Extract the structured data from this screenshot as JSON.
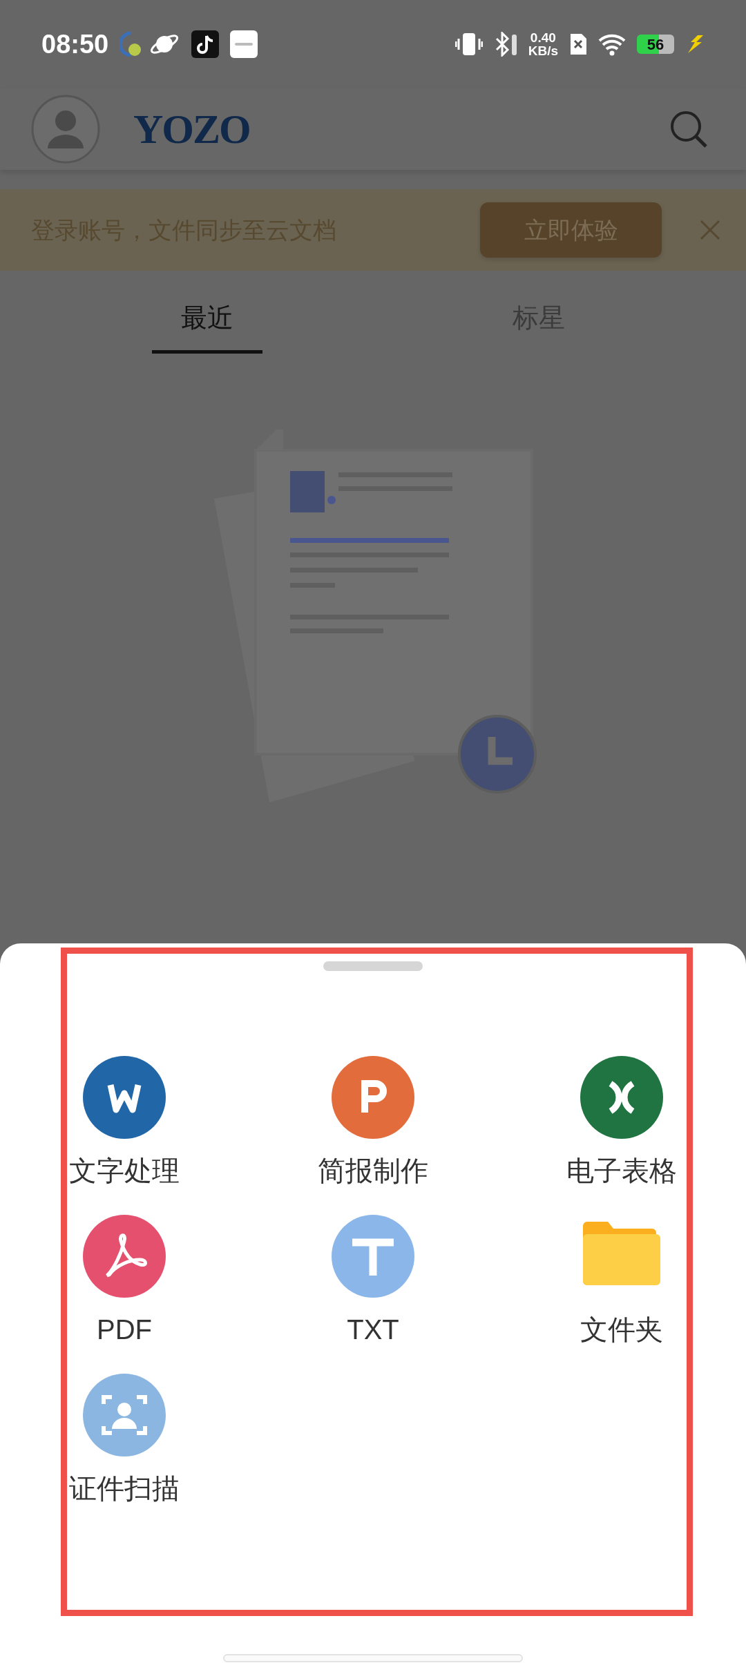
{
  "status_bar": {
    "time": "08:50",
    "network_speed": {
      "value": "0.40",
      "unit": "KB/s"
    },
    "battery": "56"
  },
  "header": {
    "logo": "YOZO"
  },
  "banner": {
    "text": "登录账号，文件同步至云文档",
    "button": "立即体验"
  },
  "tabs": [
    {
      "label": "最近",
      "selected": true
    },
    {
      "label": "标星",
      "selected": false
    }
  ],
  "new_sheet": {
    "items": [
      {
        "label": "文字处理",
        "kind": "word"
      },
      {
        "label": "简报制作",
        "kind": "slides"
      },
      {
        "label": "电子表格",
        "kind": "sheet"
      },
      {
        "label": "PDF",
        "kind": "pdf"
      },
      {
        "label": "TXT",
        "kind": "txt"
      },
      {
        "label": "文件夹",
        "kind": "folder"
      },
      {
        "label": "证件扫描",
        "kind": "scan"
      }
    ]
  }
}
